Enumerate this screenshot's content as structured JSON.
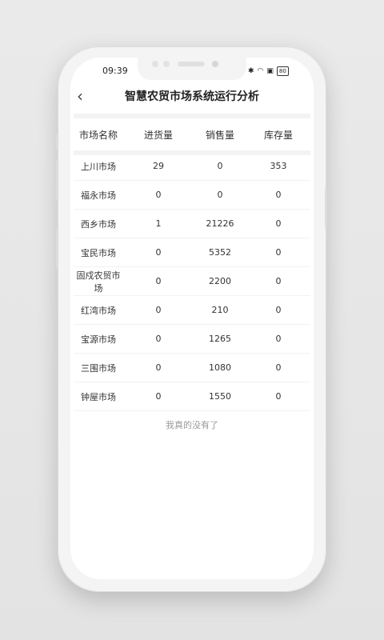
{
  "status_bar": {
    "time": "09:39",
    "icons": [
      "bluetooth-icon",
      "wifi-icon",
      "sim-icon"
    ],
    "battery": "80"
  },
  "header": {
    "back_icon": "‹",
    "title": "智慧农贸市场系统运行分析"
  },
  "table": {
    "columns": [
      "市场名称",
      "进货量",
      "销售量",
      "库存量"
    ],
    "rows": [
      [
        "上川市场",
        "29",
        "0",
        "353"
      ],
      [
        "福永市场",
        "0",
        "0",
        "0"
      ],
      [
        "西乡市场",
        "1",
        "21226",
        "0"
      ],
      [
        "宝民市场",
        "0",
        "5352",
        "0"
      ],
      [
        "固戍农贸市场",
        "0",
        "2200",
        "0"
      ],
      [
        "红湾市场",
        "0",
        "210",
        "0"
      ],
      [
        "宝源市场",
        "0",
        "1265",
        "0"
      ],
      [
        "三围市场",
        "0",
        "1080",
        "0"
      ],
      [
        "钟屋市场",
        "0",
        "1550",
        "0"
      ]
    ]
  },
  "footer": {
    "end_text": "我真的没有了"
  }
}
